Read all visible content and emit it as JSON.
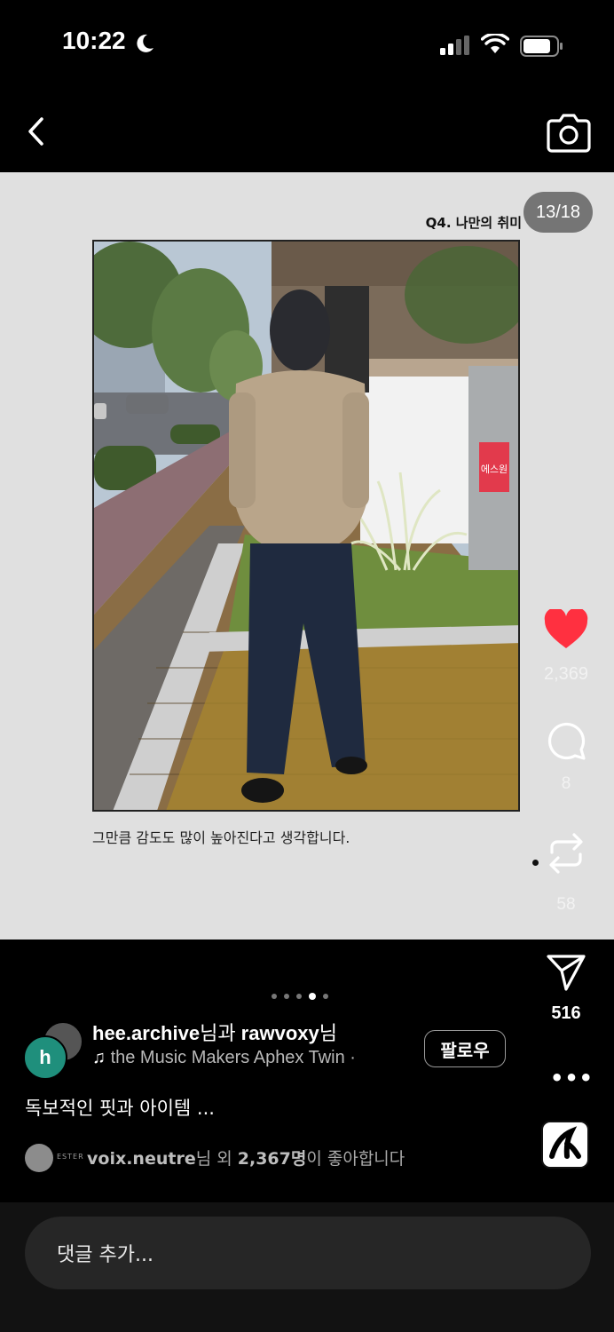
{
  "status_bar": {
    "time": "10:22"
  },
  "slide": {
    "counter": "13/18",
    "question_title": "Q4. 나만의 취미",
    "caption": "그만큼 감도도 많이 높아진다고 생각합니다.",
    "shop_sign": "에스원"
  },
  "actions": {
    "likes": "2,369",
    "comments": "8",
    "reposts": "58",
    "shares": "516",
    "more": "•••"
  },
  "post": {
    "carousel_dots": 5,
    "active_dot": 3,
    "avatar_letter": "h",
    "author_1": "hee.archive",
    "author_joiner": "님과 ",
    "author_2": "rawvoxy",
    "author_suffix": "님",
    "music": "the Music Makers    Aphex Twin ·",
    "follow_label": "팔로우",
    "description": "독보적인 핏과 아이템 ...",
    "liked_avatar_tag": "ESTER",
    "liked_user": "voix.neutre",
    "liked_mid": "님 외 ",
    "liked_count": "2,367명",
    "liked_end": "이 좋아합니다"
  },
  "comment": {
    "placeholder": "댓글 추가..."
  },
  "colors": {
    "heart": "#ff3040",
    "avatar": "#1f8f7c",
    "slide_bg": "#e0e0e0"
  }
}
